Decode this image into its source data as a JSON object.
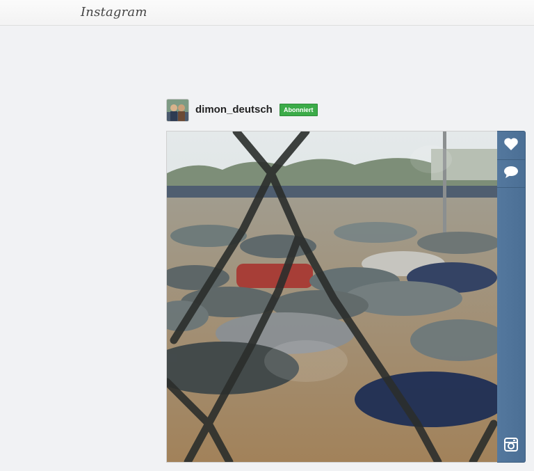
{
  "app": {
    "logo_text": "Instagram"
  },
  "post": {
    "username": "dimon_deutsch",
    "follow_status": "Abonniert",
    "photo_description_icon": "flooded-car-lot-photo"
  },
  "actions": {
    "like_icon": "heart-icon",
    "comment_icon": "speech-bubble-icon",
    "instagram_icon": "camera-icon"
  },
  "colors": {
    "follow_badge": "#3bab48",
    "action_bar": "#4f7399",
    "background": "#f1f2f4"
  }
}
